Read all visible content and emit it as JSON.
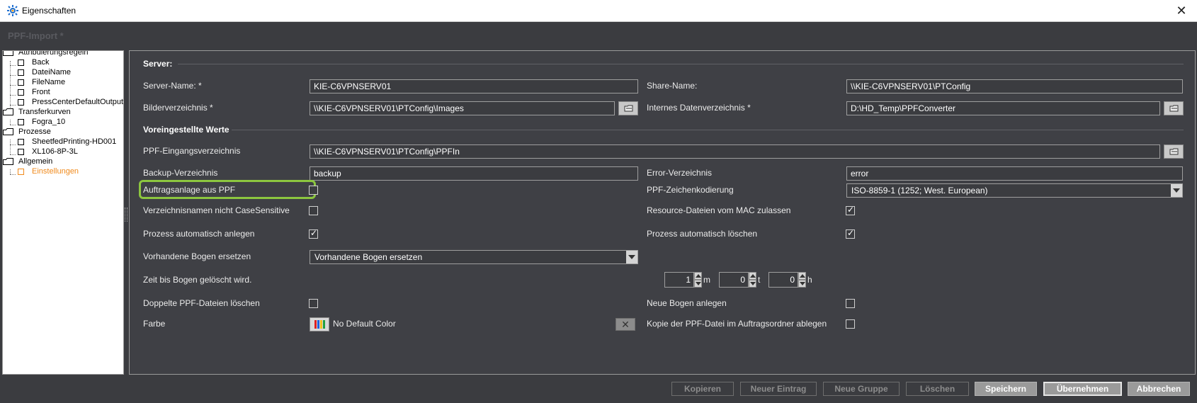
{
  "window": {
    "title": "Eigenschaften",
    "close_glyph": "✕"
  },
  "header": {
    "title": "PPF-Import *"
  },
  "tree": {
    "nodes": [
      {
        "label": "Attribuierungsregeln"
      },
      {
        "label": "Back"
      },
      {
        "label": "DateiName"
      },
      {
        "label": "FileName"
      },
      {
        "label": "Front"
      },
      {
        "label": "PressCenterDefaultOutput"
      },
      {
        "label": "Transferkurven"
      },
      {
        "label": "Fogra_10"
      },
      {
        "label": "Prozesse"
      },
      {
        "label": "SheetfedPrinting-HD001"
      },
      {
        "label": "XL106-8P-3L"
      },
      {
        "label": "Allgemein"
      },
      {
        "label": "Einstellungen"
      }
    ]
  },
  "server": {
    "section": "Server:",
    "server_name_label": "Server-Name: *",
    "server_name_value": "KIE-C6VPNSERV01",
    "share_name_label": "Share-Name:",
    "share_name_value": "\\\\KIE-C6VPNSERV01\\PTConfig",
    "bilder_label": "Bilderverzeichnis *",
    "bilder_value": "\\\\KIE-C6VPNSERV01\\PTConfig\\Images",
    "intern_label": "Internes Datenverzeichnis *",
    "intern_value": "D:\\HD_Temp\\PPFConverter"
  },
  "defaults": {
    "section": "Voreingestellte Werte",
    "eingang_label": "PPF-Eingangsverzeichnis",
    "eingang_value": "\\\\KIE-C6VPNSERV01\\PTConfig\\PPFIn",
    "backup_label": "Backup-Verzeichnis",
    "backup_value": "backup",
    "error_label": "Error-Verzeichnis",
    "error_value": "error",
    "auftrag_label": "Auftragsanlage aus PPF",
    "auftrag_checked": false,
    "zeichen_label": "PPF-Zeichenkodierung",
    "zeichen_value": "ISO-8859-1 (1252; West. European)",
    "casesens_label": "Verzeichnisnamen nicht CaseSensitive",
    "casesens_checked": false,
    "resource_label": "Resource-Dateien vom MAC zulassen",
    "resource_checked": true,
    "prozess_anlegen_label": "Prozess automatisch anlegen",
    "prozess_anlegen_checked": true,
    "prozess_loeschen_label": "Prozess automatisch löschen",
    "prozess_loeschen_checked": true,
    "bogen_label": "Vorhandene Bogen ersetzen",
    "bogen_value": "Vorhandene Bogen ersetzen",
    "zeit_label": "Zeit bis Bogen gelöscht wird.",
    "zeit_m": "1",
    "zeit_m_unit": "m",
    "zeit_t": "0",
    "zeit_t_unit": "t",
    "zeit_h": "0",
    "zeit_h_unit": "h",
    "doppelte_label": "Doppelte PPF-Dateien löschen",
    "doppelte_checked": false,
    "neue_bogen_label": "Neue Bogen anlegen",
    "neue_bogen_checked": false,
    "farbe_label": "Farbe",
    "farbe_value": "No Default Color",
    "kopie_label": "Kopie der PPF-Datei im Auftragsordner ablegen",
    "kopie_checked": false,
    "clear_glyph": "✕"
  },
  "buttons": {
    "kopieren": "Kopieren",
    "neuer_eintrag": "Neuer Eintrag",
    "neue_gruppe": "Neue Gruppe",
    "loeschen": "Löschen",
    "speichern": "Speichern",
    "uebernehmen": "Übernehmen",
    "abbrechen": "Abbrechen"
  },
  "colors": {
    "background": "#3b3c40",
    "highlight": "#8cc63f",
    "active_tree": "#f08a1c"
  },
  "icons": {
    "app": "gear-icon",
    "folder": "folder-icon",
    "browse": "browse-folder-icon",
    "dropdown": "chevron-down-icon"
  }
}
